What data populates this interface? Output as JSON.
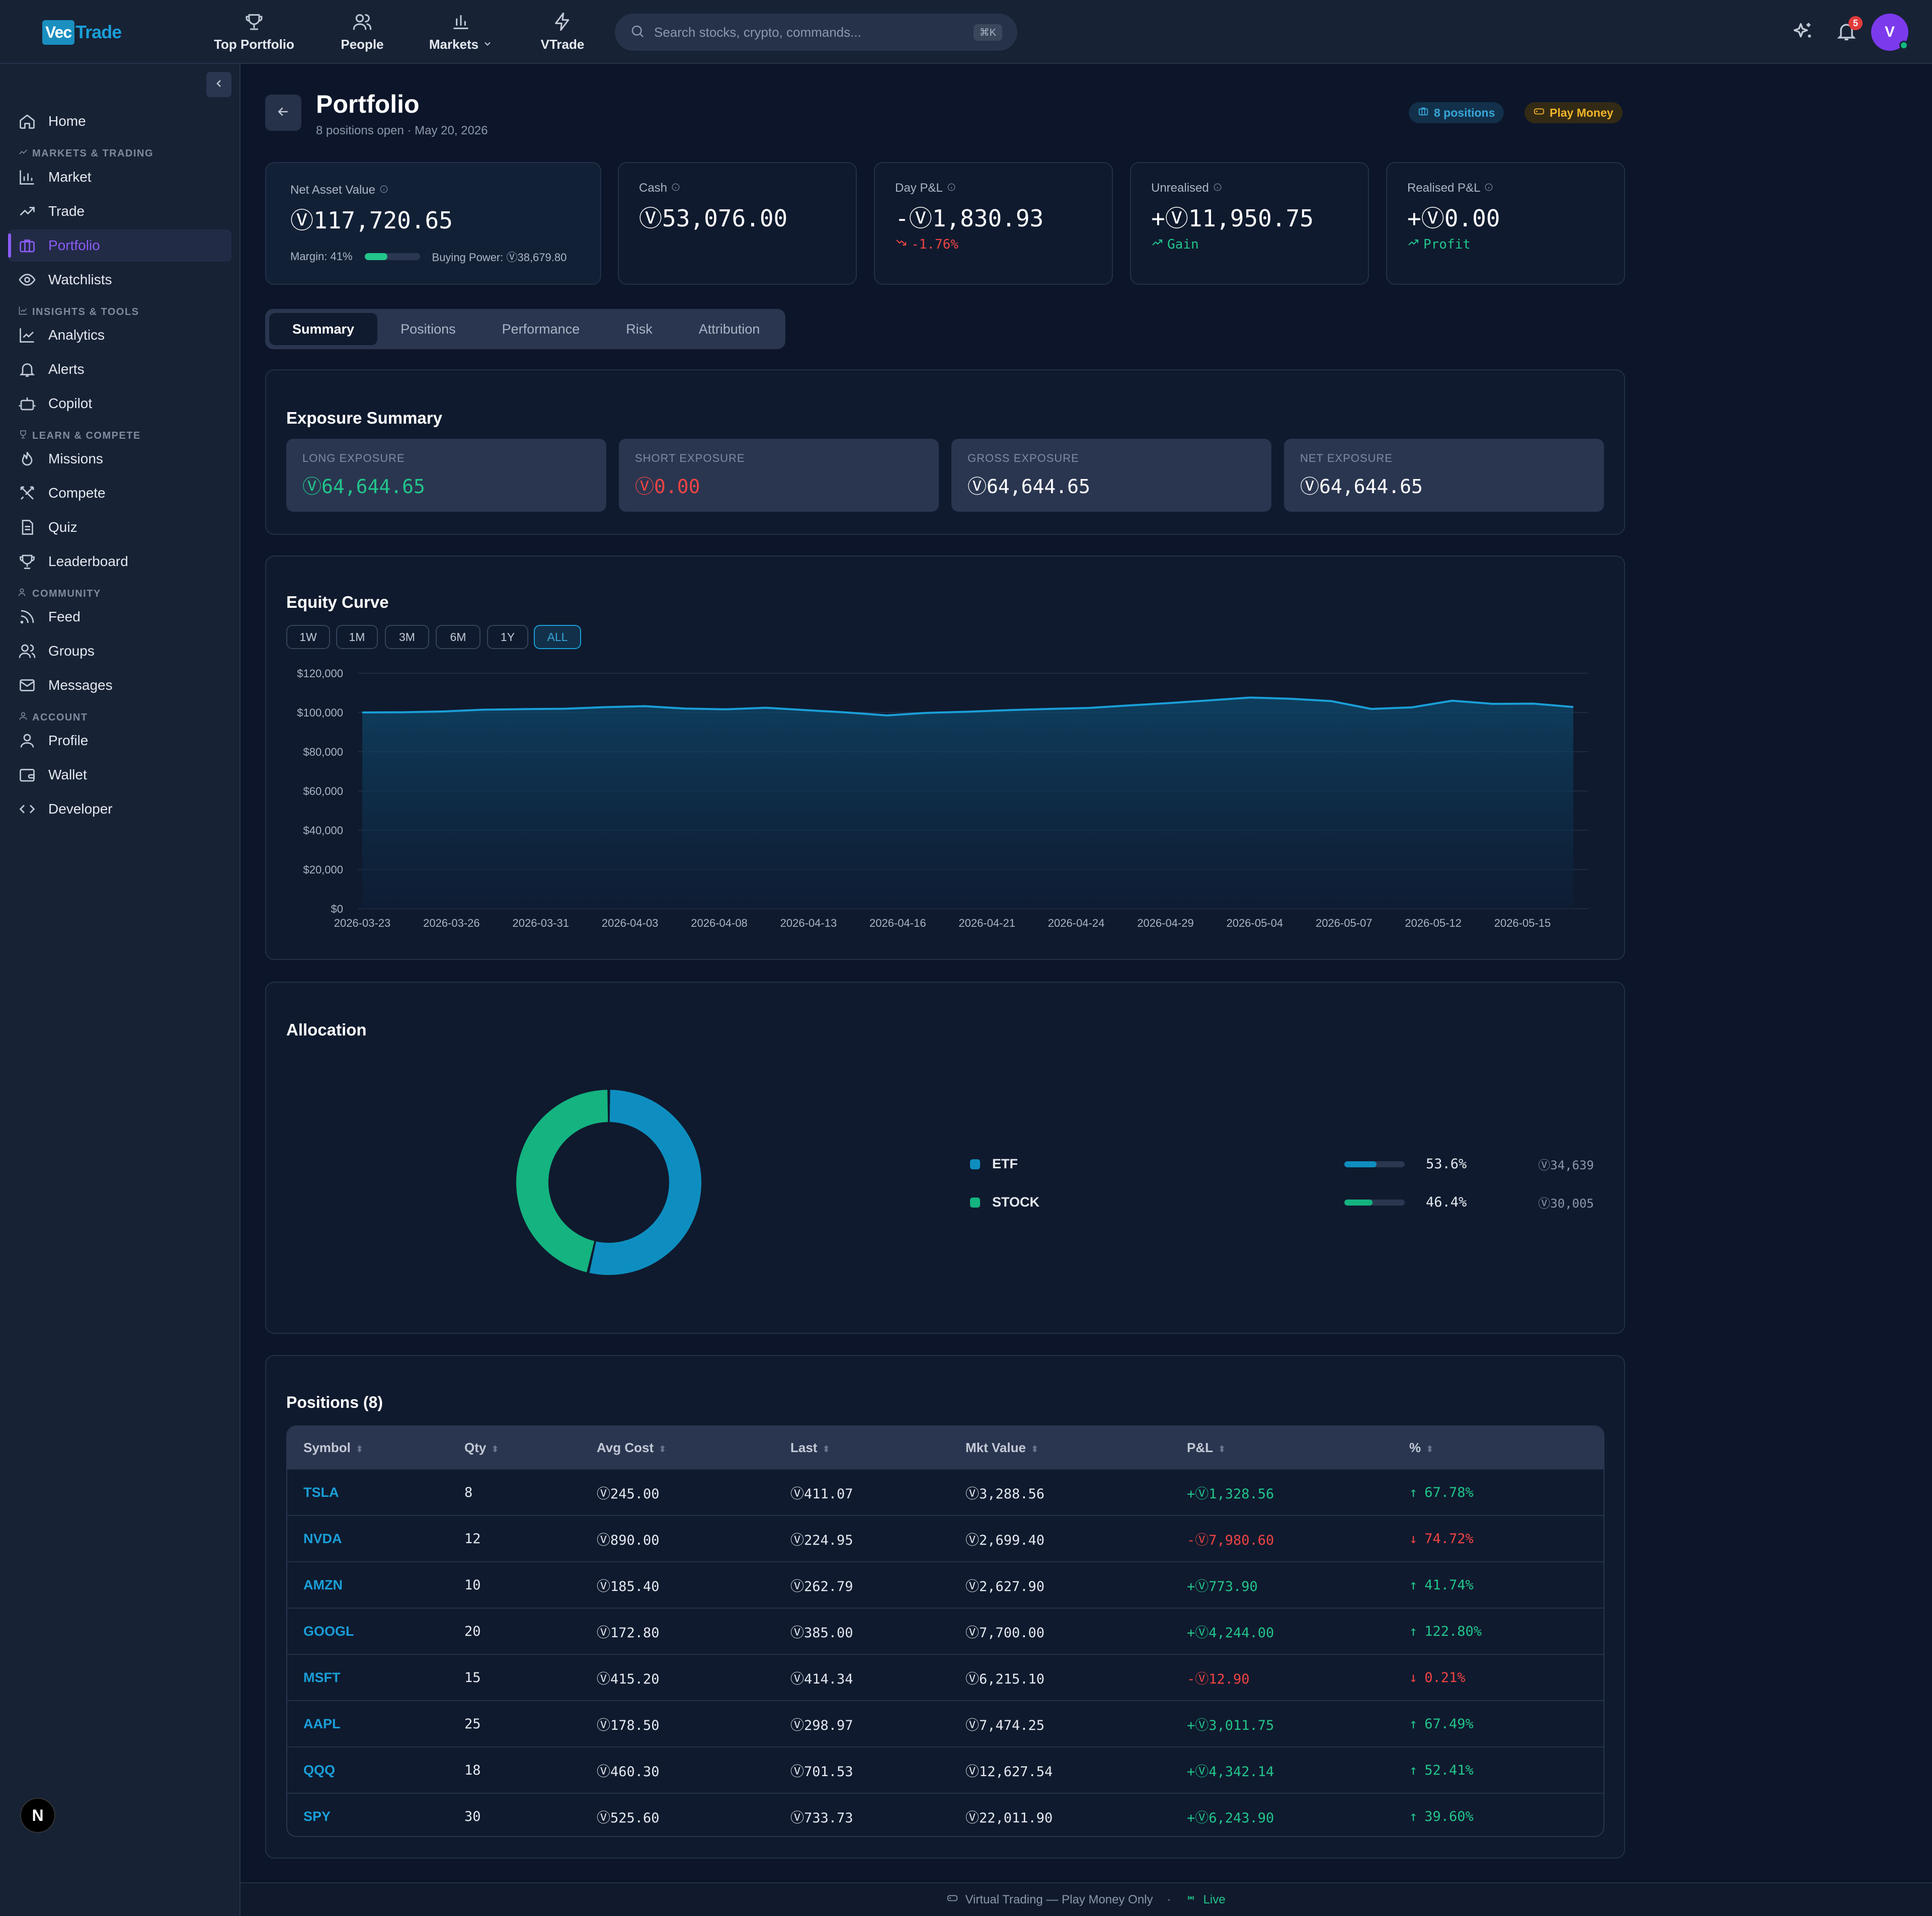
{
  "brand": {
    "logo_part1": "Vec",
    "logo_part2": "Trade"
  },
  "topnav": [
    {
      "label": "Top Portfolio",
      "icon": "trophy-icon"
    },
    {
      "label": "People",
      "icon": "users-icon"
    },
    {
      "label": "Markets",
      "icon": "bar-chart-icon"
    },
    {
      "label": "VTrade",
      "icon": "bolt-icon"
    }
  ],
  "search": {
    "placeholder": "Search stocks, crypto, commands...",
    "shortcut": "⌘K"
  },
  "header_right": {
    "notification_count": "5",
    "avatar_initial": "V"
  },
  "sidebar": {
    "home": "Home",
    "sections": {
      "markets": "MARKETS & TRADING",
      "insights": "INSIGHTS & TOOLS",
      "learn": "LEARN & COMPETE",
      "community": "COMMUNITY",
      "account": "ACCOUNT"
    },
    "items": {
      "market": "Market",
      "trade": "Trade",
      "portfolio": "Portfolio",
      "watchlists": "Watchlists",
      "analytics": "Analytics",
      "alerts": "Alerts",
      "copilot": "Copilot",
      "missions": "Missions",
      "compete": "Compete",
      "quiz": "Quiz",
      "leaderboard": "Leaderboard",
      "feed": "Feed",
      "groups": "Groups",
      "messages": "Messages",
      "profile": "Profile",
      "wallet": "Wallet",
      "developer": "Developer"
    },
    "framework_badge": "N"
  },
  "page": {
    "title": "Portfolio",
    "subtitle": "8 positions open · May 20, 2026",
    "positions_pill": "8 positions",
    "play_pill": "Play Money"
  },
  "stats": {
    "nav": {
      "label": "Net Asset Value",
      "value": "Ⓥ117,720.65",
      "margin_label": "Margin: 41%",
      "margin_fraction": 0.41,
      "buying_power": "Buying Power: Ⓥ38,679.80"
    },
    "cash": {
      "label": "Cash",
      "value": "Ⓥ53,076.00"
    },
    "day_pnl": {
      "label": "Day P&L",
      "value": "-Ⓥ1,830.93",
      "sub": "-1.76%"
    },
    "unrealised": {
      "label": "Unrealised",
      "value": "+Ⓥ11,950.75",
      "sub": "Gain"
    },
    "realised": {
      "label": "Realised P&L",
      "value": "+Ⓥ0.00",
      "sub": "Profit"
    }
  },
  "tabs": [
    "Summary",
    "Positions",
    "Performance",
    "Risk",
    "Attribution"
  ],
  "exposure": {
    "title": "Exposure Summary",
    "long": {
      "label": "LONG EXPOSURE",
      "value": "Ⓥ64,644.65"
    },
    "short": {
      "label": "SHORT EXPOSURE",
      "value": "Ⓥ0.00"
    },
    "gross": {
      "label": "GROSS EXPOSURE",
      "value": "Ⓥ64,644.65"
    },
    "net": {
      "label": "NET EXPOSURE",
      "value": "Ⓥ64,644.65"
    }
  },
  "equity": {
    "title": "Equity Curve",
    "ranges": [
      "1W",
      "1M",
      "3M",
      "6M",
      "1Y",
      "ALL"
    ],
    "active_range": "ALL"
  },
  "chart_data": [
    {
      "type": "area",
      "title": "Equity Curve",
      "xlabel": "",
      "ylabel": "",
      "ylim": [
        0,
        120000
      ],
      "y_ticks": [
        "$0",
        "$20,000",
        "$40,000",
        "$60,000",
        "$80,000",
        "$100,000",
        "$120,000"
      ],
      "x_ticks": [
        "2026-03-23",
        "2026-03-26",
        "2026-03-31",
        "2026-04-03",
        "2026-04-08",
        "2026-04-13",
        "2026-04-16",
        "2026-04-21",
        "2026-04-24",
        "2026-04-29",
        "2026-05-04",
        "2026-05-07",
        "2026-05-12",
        "2026-05-15"
      ],
      "values": [
        100000,
        100100,
        100500,
        101400,
        101700,
        101900,
        102700,
        103200,
        102000,
        101600,
        102400,
        101200,
        100000,
        98500,
        99800,
        100400,
        101200,
        101800,
        102300,
        103600,
        104800,
        106200,
        107600,
        107000,
        105800,
        101800,
        102600,
        106000,
        104400,
        104500,
        102800
      ],
      "grid": true,
      "color": "#1a9fd8"
    },
    {
      "type": "pie",
      "title": "Allocation",
      "categories": [
        "ETF",
        "STOCK"
      ],
      "values": [
        53.6,
        46.4
      ],
      "amounts": [
        "Ⓥ34,639",
        "Ⓥ30,005"
      ],
      "pct_labels": [
        "53.6%",
        "46.4%"
      ],
      "colors": [
        "#0e8ec0",
        "#14b37f"
      ]
    }
  ],
  "positions": {
    "title": "Positions (8)",
    "columns": [
      "Symbol",
      "Qty",
      "Avg Cost",
      "Last",
      "Mkt Value",
      "P&L",
      "%"
    ],
    "rows": [
      {
        "sym": "TSLA",
        "qty": "8",
        "avg": "Ⓥ245.00",
        "last": "Ⓥ411.07",
        "mkt": "Ⓥ3,288.56",
        "pnl": "+Ⓥ1,328.56",
        "pct": "67.78%",
        "up": true
      },
      {
        "sym": "NVDA",
        "qty": "12",
        "avg": "Ⓥ890.00",
        "last": "Ⓥ224.95",
        "mkt": "Ⓥ2,699.40",
        "pnl": "-Ⓥ7,980.60",
        "pct": "74.72%",
        "up": false
      },
      {
        "sym": "AMZN",
        "qty": "10",
        "avg": "Ⓥ185.40",
        "last": "Ⓥ262.79",
        "mkt": "Ⓥ2,627.90",
        "pnl": "+Ⓥ773.90",
        "pct": "41.74%",
        "up": true
      },
      {
        "sym": "GOOGL",
        "qty": "20",
        "avg": "Ⓥ172.80",
        "last": "Ⓥ385.00",
        "mkt": "Ⓥ7,700.00",
        "pnl": "+Ⓥ4,244.00",
        "pct": "122.80%",
        "up": true
      },
      {
        "sym": "MSFT",
        "qty": "15",
        "avg": "Ⓥ415.20",
        "last": "Ⓥ414.34",
        "mkt": "Ⓥ6,215.10",
        "pnl": "-Ⓥ12.90",
        "pct": "0.21%",
        "up": false
      },
      {
        "sym": "AAPL",
        "qty": "25",
        "avg": "Ⓥ178.50",
        "last": "Ⓥ298.97",
        "mkt": "Ⓥ7,474.25",
        "pnl": "+Ⓥ3,011.75",
        "pct": "67.49%",
        "up": true
      },
      {
        "sym": "QQQ",
        "qty": "18",
        "avg": "Ⓥ460.30",
        "last": "Ⓥ701.53",
        "mkt": "Ⓥ12,627.54",
        "pnl": "+Ⓥ4,342.14",
        "pct": "52.41%",
        "up": true
      },
      {
        "sym": "SPY",
        "qty": "30",
        "avg": "Ⓥ525.60",
        "last": "Ⓥ733.73",
        "mkt": "Ⓥ22,011.90",
        "pnl": "+Ⓥ6,243.90",
        "pct": "39.60%",
        "up": true
      }
    ]
  },
  "footer": {
    "text": "Virtual Trading — Play Money Only",
    "sep": "·",
    "live": "Live"
  }
}
